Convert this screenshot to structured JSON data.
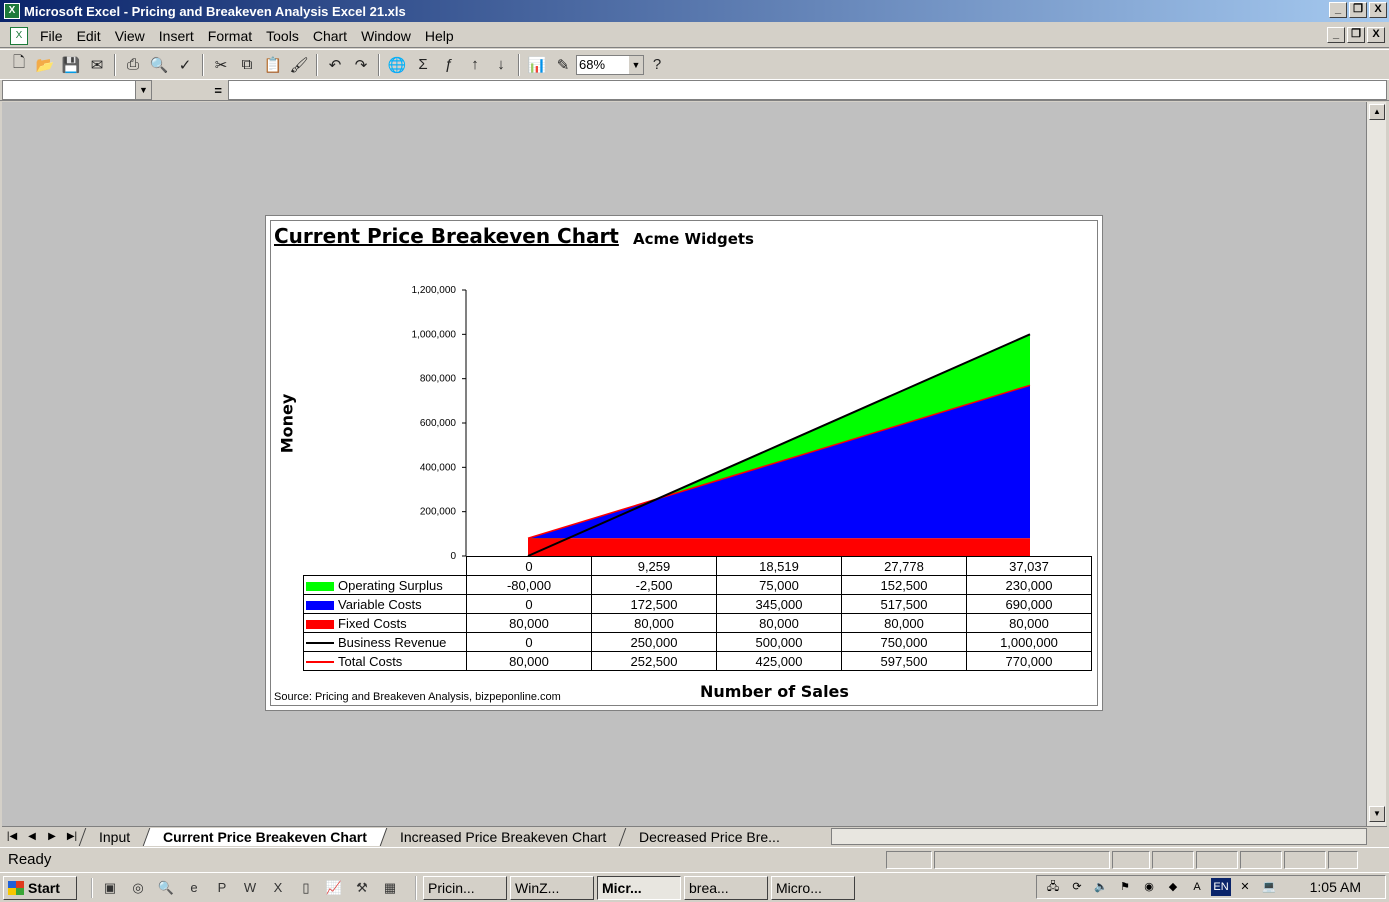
{
  "window": {
    "title": "Microsoft Excel - Pricing and Breakeven Analysis Excel 21.xls",
    "min": "_",
    "restore": "❐",
    "close": "X"
  },
  "menu": [
    "File",
    "Edit",
    "View",
    "Insert",
    "Format",
    "Tools",
    "Chart",
    "Window",
    "Help"
  ],
  "toolbar": {
    "zoom": "68%"
  },
  "formula": {
    "equals": "="
  },
  "chart": {
    "title": "Current Price Breakeven Chart",
    "subtitle": "Acme Widgets",
    "ylabel": "Money",
    "xlabel": "Number of Sales",
    "source": "Source: Pricing and Breakeven Analysis, bizpeponline.com",
    "yticks": [
      "1,200,000",
      "1,000,000",
      "800,000",
      "600,000",
      "400,000",
      "200,000",
      "0"
    ]
  },
  "chart_data": {
    "type": "area",
    "title": "Current Price Breakeven Chart",
    "subtitle": "Acme Widgets",
    "xlabel": "Number of Sales",
    "ylabel": "Money",
    "ylim": [
      0,
      1200000
    ],
    "categories": [
      "0",
      "9,259",
      "18,519",
      "27,778",
      "37,037"
    ],
    "x": [
      0,
      9259,
      18519,
      27778,
      37037
    ],
    "series": [
      {
        "name": "Operating Surplus",
        "kind": "area",
        "color": "#00ff00",
        "values": [
          -80000,
          -2500,
          75000,
          152500,
          230000
        ],
        "display": [
          "-80,000",
          "-2,500",
          "75,000",
          "152,500",
          "230,000"
        ]
      },
      {
        "name": "Variable Costs",
        "kind": "area",
        "color": "#0000ff",
        "values": [
          0,
          172500,
          345000,
          517500,
          690000
        ],
        "display": [
          "0",
          "172,500",
          "345,000",
          "517,500",
          "690,000"
        ]
      },
      {
        "name": "Fixed Costs",
        "kind": "area",
        "color": "#ff0000",
        "values": [
          80000,
          80000,
          80000,
          80000,
          80000
        ],
        "display": [
          "80,000",
          "80,000",
          "80,000",
          "80,000",
          "80,000"
        ]
      },
      {
        "name": "Business Revenue",
        "kind": "line",
        "color": "#000000",
        "values": [
          0,
          250000,
          500000,
          750000,
          1000000
        ],
        "display": [
          "0",
          "250,000",
          "500,000",
          "750,000",
          "1,000,000"
        ]
      },
      {
        "name": "Total Costs",
        "kind": "line",
        "color": "#ff0000",
        "values": [
          80000,
          252500,
          425000,
          597500,
          770000
        ],
        "display": [
          "80,000",
          "252,500",
          "425,000",
          "597,500",
          "770,000"
        ]
      }
    ],
    "legend": "data table",
    "grid": false
  },
  "sheets": {
    "tabs": [
      "Input",
      "Current Price Breakeven Chart",
      "Increased Price Breakeven Chart",
      "Decreased Price Bre..."
    ],
    "active": 1
  },
  "status": {
    "text": "Ready"
  },
  "taskbar": {
    "start": "Start",
    "tasks": [
      "Pricin...",
      "WinZ...",
      "Micr...",
      "brea...",
      "Micro..."
    ],
    "active_task": 2,
    "clock": "1:05 AM",
    "tray_lang": "EN"
  }
}
